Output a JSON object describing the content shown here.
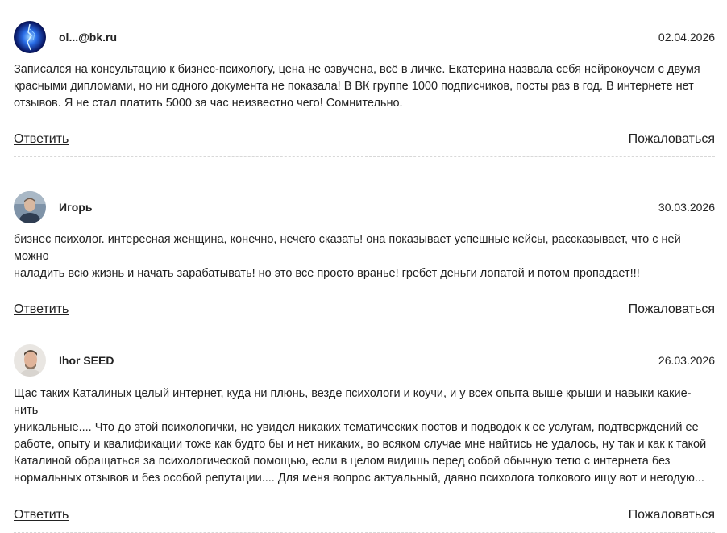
{
  "comments": [
    {
      "author": "ol...@bk.ru",
      "date": "02.04.2026",
      "avatar_icon": "blue-glow-avatar-icon",
      "text": "Записался на консультацию к бизнес-психологу, цена не озвучена, всё в личке. Екатерина назвала себя нейрокоучем с двумя\nкрасными дипломами, но ни одного документа не показала! В ВК группе 1000 подписчиков, посты раз в год. В интернете нет\nотзывов. Я не стал платить 5000 за час неизвестно чего! Сомнительно.",
      "reply_label": "Ответить",
      "report_label": "Пожаловаться"
    },
    {
      "author": "Игорь",
      "date": "30.03.2026",
      "avatar_icon": "man-photo-avatar-icon",
      "text": "бизнес психолог. интересная женщина, конечно, нечего сказать! она показывает успешные кейсы, рассказывает, что с ней можно\nналадить всю жизнь и начать зарабатывать! но это все просто вранье! гребет деньги лопатой и потом пропадает!!!",
      "reply_label": "Ответить",
      "report_label": "Пожаловаться"
    },
    {
      "author": "Ihor SEED",
      "date": "26.03.2026",
      "avatar_icon": "man-photo-avatar-icon",
      "text": "Щас таких Каталиных целый интернет, куда ни плюнь, везде психологи и коучи, и у всех опыта выше крыши и навыки какие-нить\nуникальные.... Что до этой психологички, не увидел никаких тематических постов и подводок к ее услугам, подтверждений ее\nработе, опыту и квалификации тоже как будто бы и нет никаких, во всяком случае мне найтись не удалось, ну так и как к такой\nКаталиной обращаться за психологической помощью, если в целом видишь перед собой обычную тетю с интернета без\nнормальных отзывов и без особой репутации.... Для меня вопрос актуальный, давно психолога толкового ищу вот и негодую...",
      "reply_label": "Ответить",
      "report_label": "Пожаловаться"
    }
  ]
}
